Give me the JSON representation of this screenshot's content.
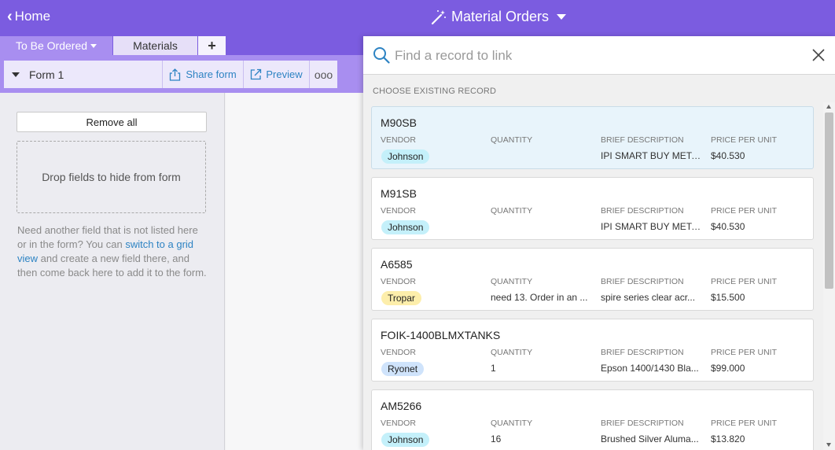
{
  "header": {
    "home_label": "Home",
    "base_title": "Material Orders"
  },
  "tabs": [
    {
      "label": "To Be Ordered"
    },
    {
      "label": "Materials"
    },
    {
      "label": "+"
    }
  ],
  "viewbar": {
    "form_name": "Form 1",
    "share_label": "Share form",
    "preview_label": "Preview",
    "more_label": "ooo"
  },
  "leftpanel": {
    "remove_all": "Remove all",
    "dropzone": "Drop fields to hide from form",
    "help_1": "Need another field that is not listed here or in the form? You can ",
    "help_link": "switch to a grid view",
    "help_2": " and create a new field there, and then come back here to add it to the form."
  },
  "picker": {
    "placeholder": "Find a record to link",
    "section_label": "CHOOSE EXISTING RECORD",
    "labels": {
      "vendor": "VENDOR",
      "quantity": "QUANTITY",
      "description": "BRIEF DESCRIPTION",
      "price": "PRICE PER UNIT"
    },
    "records": [
      {
        "name": "M90SB",
        "vendor": "Johnson",
        "vendor_color": "#c4f0fa",
        "quantity": "",
        "description": "IPI SMART BUY META...",
        "price": "$40.530"
      },
      {
        "name": "M91SB",
        "vendor": "Johnson",
        "vendor_color": "#c4f0fa",
        "quantity": "",
        "description": "IPI SMART BUY META...",
        "price": "$40.530"
      },
      {
        "name": "A6585",
        "vendor": "Tropar",
        "vendor_color": "#fdeeab",
        "quantity": "need 13. Order in an ...",
        "description": "spire series clear acr...",
        "price": "$15.500"
      },
      {
        "name": "FOIK-1400BLMXTANKS",
        "vendor": "Ryonet",
        "vendor_color": "#cfe3fb",
        "quantity": "1",
        "description": "Epson 1400/1430 Bla...",
        "price": "$99.000"
      },
      {
        "name": "AM5266",
        "vendor": "Johnson",
        "vendor_color": "#c4f0fa",
        "quantity": "16",
        "description": "Brushed Silver Aluma...",
        "price": "$13.820"
      }
    ]
  },
  "colors": {
    "brand": "#7b5ce0",
    "brand_light": "#a88ef0",
    "link": "#2d83c3"
  }
}
